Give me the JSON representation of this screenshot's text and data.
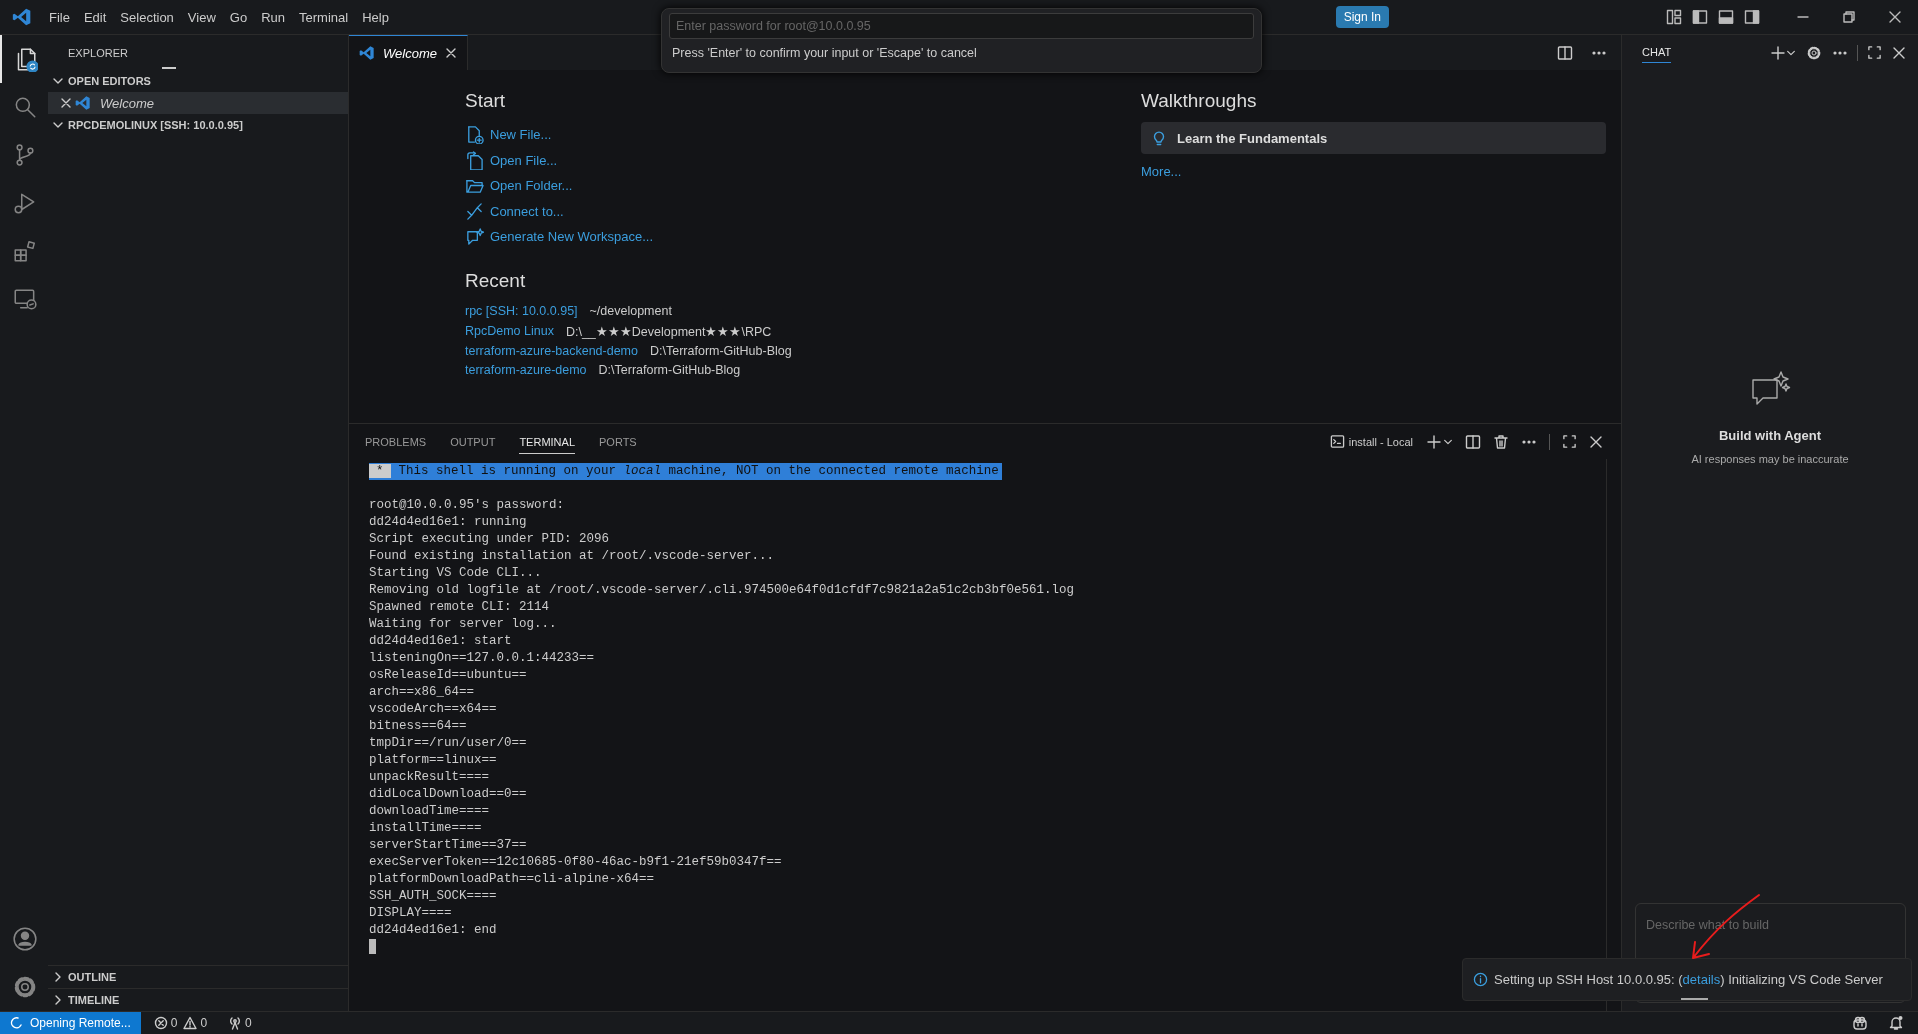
{
  "menu": [
    "File",
    "Edit",
    "Selection",
    "View",
    "Go",
    "Run",
    "Terminal",
    "Help"
  ],
  "quick_input": {
    "placeholder": "Enter password for root@10.0.0.95",
    "hint": "Press 'Enter' to confirm your input or 'Escape' to cancel"
  },
  "sign_in": "Sign In",
  "activity_bar": [
    {
      "kind": "explorer",
      "selected": true
    },
    {
      "kind": "search",
      "selected": false
    },
    {
      "kind": "source-control",
      "selected": false
    },
    {
      "kind": "run",
      "selected": false
    },
    {
      "kind": "extensions",
      "selected": false
    },
    {
      "kind": "remote",
      "selected": false
    }
  ],
  "sidebar": {
    "title": "EXPLORER",
    "open_editors": {
      "title": "OPEN EDITORS",
      "expanded": true,
      "items": [
        {
          "label": "Welcome",
          "selected": true
        }
      ]
    },
    "folder": {
      "title": "RPCDEMOLINUX [SSH: 10.0.0.95]",
      "expanded": true
    },
    "bottom_sections": [
      {
        "title": "OUTLINE",
        "expanded": false
      },
      {
        "title": "TIMELINE",
        "expanded": false
      }
    ]
  },
  "editor": {
    "tabs": [
      {
        "label": "Welcome",
        "selected": true
      }
    ],
    "start": {
      "heading": "Start",
      "actions": [
        {
          "kind": "new-file",
          "label": "New File..."
        },
        {
          "kind": "open-file",
          "label": "Open File..."
        },
        {
          "kind": "open-folder",
          "label": "Open Folder..."
        },
        {
          "kind": "connect",
          "label": "Connect to..."
        },
        {
          "kind": "generate",
          "label": "Generate New Workspace..."
        }
      ]
    },
    "recent": {
      "heading": "Recent",
      "items": [
        {
          "name": "rpc [SSH: 10.0.0.95]",
          "path": "~/development"
        },
        {
          "name": "RpcDemo Linux",
          "path": "D:\\__★★★Development★★★\\RPC"
        },
        {
          "name": "terraform-azure-backend-demo",
          "path": "D:\\Terraform-GitHub-Blog"
        },
        {
          "name": "terraform-azure-demo",
          "path": "D:\\Terraform-GitHub-Blog"
        }
      ]
    },
    "walkthroughs": {
      "heading": "Walkthroughs",
      "items": [
        {
          "label": "Learn the Fundamentals"
        }
      ],
      "more": "More..."
    }
  },
  "panel": {
    "tabs": [
      {
        "label": "PROBLEMS",
        "selected": false
      },
      {
        "label": "OUTPUT",
        "selected": false
      },
      {
        "label": "TERMINAL",
        "selected": true
      },
      {
        "label": "PORTS",
        "selected": false
      }
    ],
    "terminal_name": "install - Local",
    "banner": {
      "marker": "*",
      "text": "This shell is running on your *local* machine, NOT on the connected remote machine"
    },
    "lines": [
      "root@10.0.0.95's password:",
      "dd24d4ed16e1: running",
      "Script executing under PID: 2096",
      "Found existing installation at /root/.vscode-server...",
      "Starting VS Code CLI...",
      "Removing old logfile at /root/.vscode-server/.cli.974500e64f0d1cfdf7c9821a2a51c2cb3bf0e561.log",
      "Spawned remote CLI: 2114",
      "Waiting for server log...",
      "dd24d4ed16e1: start",
      "listeningOn==127.0.0.1:44233==",
      "osReleaseId==ubuntu==",
      "arch==x86_64==",
      "vscodeArch==x64==",
      "bitness==64==",
      "tmpDir==/run/user/0==",
      "platform==linux==",
      "unpackResult====",
      "didLocalDownload==0==",
      "downloadTime====",
      "installTime====",
      "serverStartTime==37==",
      "execServerToken==12c10685-0f80-46ac-b9f1-21ef59b0347f==",
      "platformDownloadPath==cli-alpine-x64==",
      "SSH_AUTH_SOCK====",
      "DISPLAY====",
      "dd24d4ed16e1: end"
    ]
  },
  "chat": {
    "title": "CHAT",
    "heading": "Build with Agent",
    "subtitle": "AI responses may be inaccurate",
    "input_placeholder": "Describe what to build"
  },
  "notification": {
    "message_start": "Setting up SSH Host 10.0.0.95: (",
    "link": "details",
    "message_end": ") Initializing VS Code Server"
  },
  "status_bar": {
    "remote": "Opening Remote...",
    "errors": "0",
    "warnings": "0",
    "ports": "0"
  }
}
